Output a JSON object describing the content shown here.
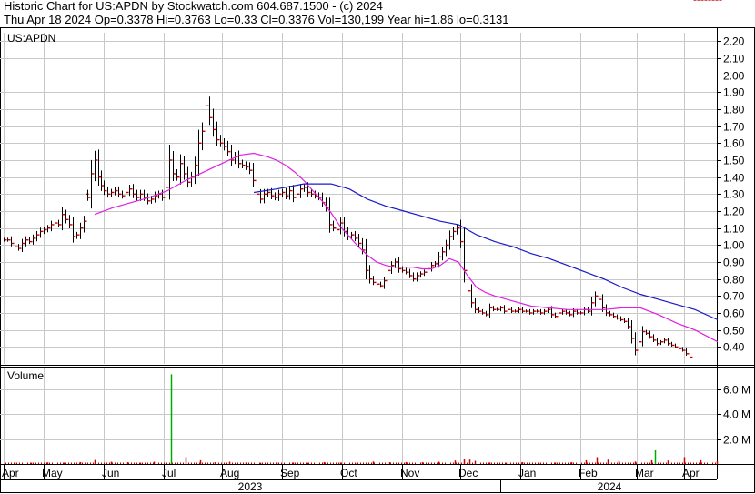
{
  "header": {
    "line1": "Historic Chart for US:APDN by Stockwatch.com 604.687.1500 - (c) 2024",
    "line2": "Thu Apr 18 2024   Op=0.3378   Hi=0.3763   Lo=0.33   Cl=0.3376   Vol=130,199   Year hi=1.86   lo=0.3131"
  },
  "colors": {
    "price_bar": "#000000",
    "close_tick": "#cc0000",
    "ma_short": "#e020e0",
    "ma_long": "#1a1acc",
    "volume_bar": "#cc0000",
    "volume_spike": "#00aa00",
    "grid": "#c8c8c8"
  },
  "chart_data": [
    {
      "type": "bar",
      "subtype": "ohlc",
      "symbol_label": "US:APDN",
      "yticks": [
        "0.40",
        "0.50",
        "0.60",
        "0.70",
        "0.80",
        "0.90",
        "1.00",
        "1.10",
        "1.20",
        "1.30",
        "1.40",
        "1.50",
        "1.60",
        "1.70",
        "1.80",
        "1.90",
        "2.00",
        "2.10",
        "2.20"
      ],
      "ylim": [
        0.3,
        2.25
      ],
      "months": [
        "Apr",
        "May",
        "Jun",
        "Jul",
        "Aug",
        "Sep",
        "Oct",
        "Nov",
        "Dec",
        "Jan",
        "Feb",
        "Mar",
        "Apr"
      ],
      "years": [
        "2023",
        "2024"
      ],
      "grid": true,
      "series": [
        {
          "kind": "ohlc_close_path",
          "x": [
            0,
            4,
            8,
            12,
            16,
            20,
            24,
            28,
            32,
            36,
            40,
            44,
            48,
            52,
            56,
            60,
            64,
            68,
            72,
            76,
            80,
            84,
            88,
            90,
            92,
            96,
            100,
            104,
            107,
            110,
            114,
            118,
            122,
            126,
            130,
            134,
            138,
            142,
            146,
            150,
            154,
            158,
            162,
            166,
            170,
            174,
            178,
            182,
            186,
            190,
            194,
            198,
            202,
            206,
            210,
            214,
            218,
            222,
            226,
            230,
            234,
            238,
            242,
            246,
            250,
            254,
            258,
            262,
            266,
            270,
            274,
            278,
            282,
            286,
            290,
            294,
            298,
            302,
            306,
            310,
            314,
            318,
            322,
            326,
            330,
            334,
            338,
            342,
            346,
            350,
            354,
            358,
            362,
            366,
            370,
            374,
            378,
            382,
            386,
            390,
            394,
            398,
            402,
            406,
            410,
            414,
            418,
            422,
            426,
            430,
            434,
            438,
            442,
            446,
            450,
            454,
            458,
            462,
            466,
            470,
            474,
            478,
            482,
            486,
            490,
            494,
            498,
            502,
            506,
            510,
            514,
            518,
            522,
            526,
            530,
            534,
            538,
            542,
            546,
            550,
            554,
            558,
            562,
            566,
            570,
            574,
            578,
            582,
            586,
            590,
            594,
            598,
            602,
            606,
            610,
            614,
            618,
            622,
            626,
            630,
            634,
            638,
            642,
            646,
            650,
            654,
            658,
            662,
            666,
            670,
            674,
            678,
            682,
            686,
            690,
            694,
            698,
            702,
            706,
            710,
            714,
            718,
            722,
            726,
            730,
            734,
            738,
            742,
            746,
            750,
            754,
            758,
            762,
            766,
            770,
            774,
            778,
            782,
            786
          ],
          "close": [
            1.03,
            1.03,
            1.01,
            0.99,
            0.98,
            1.01,
            1.03,
            1.02,
            1.04,
            1.06,
            1.08,
            1.09,
            1.1,
            1.12,
            1.13,
            1.12,
            1.18,
            1.15,
            1.12,
            1.05,
            1.06,
            1.1,
            1.14,
            1.3,
            1.28,
            1.42,
            1.5,
            1.4,
            1.35,
            1.32,
            1.3,
            1.31,
            1.32,
            1.3,
            1.29,
            1.31,
            1.33,
            1.3,
            1.28,
            1.3,
            1.28,
            1.26,
            1.27,
            1.29,
            1.3,
            1.28,
            1.34,
            1.5,
            1.42,
            1.4,
            1.48,
            1.42,
            1.37,
            1.4,
            1.47,
            1.6,
            1.67,
            1.82,
            1.75,
            1.68,
            1.62,
            1.6,
            1.58,
            1.55,
            1.5,
            1.52,
            1.48,
            1.47,
            1.46,
            1.44,
            1.38,
            1.3,
            1.27,
            1.3,
            1.31,
            1.29,
            1.28,
            1.3,
            1.31,
            1.29,
            1.32,
            1.28,
            1.3,
            1.33,
            1.34,
            1.31,
            1.3,
            1.29,
            1.28,
            1.25,
            1.22,
            1.12,
            1.1,
            1.09,
            1.13,
            1.08,
            1.05,
            1.06,
            1.04,
            1.01,
            0.97,
            0.85,
            0.8,
            0.78,
            0.77,
            0.76,
            0.79,
            0.85,
            0.88,
            0.9,
            0.86,
            0.85,
            0.84,
            0.82,
            0.8,
            0.82,
            0.83,
            0.84,
            0.86,
            0.88,
            0.89,
            0.93,
            0.96,
            1.0,
            1.05,
            1.08,
            1.1,
            1.02,
            0.85,
            0.73,
            0.66,
            0.62,
            0.61,
            0.6,
            0.59,
            0.63,
            0.62,
            0.62,
            0.63,
            0.61,
            0.62,
            0.61,
            0.61,
            0.62,
            0.61,
            0.61,
            0.6,
            0.61,
            0.61,
            0.6,
            0.61,
            0.62,
            0.59,
            0.58,
            0.6,
            0.61,
            0.6,
            0.59,
            0.61,
            0.6,
            0.6,
            0.62,
            0.61,
            0.66,
            0.7,
            0.68,
            0.63,
            0.6,
            0.59,
            0.58,
            0.57,
            0.56,
            0.55,
            0.52,
            0.45,
            0.38,
            0.43,
            0.49,
            0.48,
            0.46,
            0.44,
            0.42,
            0.43,
            0.44,
            0.42,
            0.41,
            0.4,
            0.39,
            0.38,
            0.36,
            0.34
          ]
        },
        {
          "kind": "moving_average_short",
          "x": [
            0,
            40,
            80,
            100,
            120,
            140,
            160,
            180,
            200,
            220,
            240,
            260,
            275,
            290,
            300,
            310,
            320,
            330,
            340,
            350,
            360,
            370,
            380,
            390,
            400,
            410,
            420,
            430,
            440,
            450,
            460,
            470,
            480,
            490,
            500,
            510,
            520,
            530,
            540,
            560,
            580,
            600,
            620,
            640,
            660,
            680,
            700,
            720,
            740,
            760,
            785
          ],
          "values": [
            null,
            null,
            null,
            1.18,
            1.22,
            1.25,
            1.28,
            1.32,
            1.38,
            1.43,
            1.48,
            1.53,
            1.54,
            1.52,
            1.5,
            1.47,
            1.43,
            1.38,
            1.32,
            1.26,
            1.19,
            1.11,
            1.05,
            0.99,
            0.94,
            0.9,
            0.88,
            0.87,
            0.87,
            0.87,
            0.86,
            0.86,
            0.88,
            0.92,
            0.9,
            0.82,
            0.75,
            0.72,
            0.7,
            0.67,
            0.64,
            0.63,
            0.62,
            0.62,
            0.62,
            0.63,
            0.63,
            0.59,
            0.54,
            0.5,
            0.43
          ]
        },
        {
          "kind": "moving_average_long",
          "x": [
            275,
            300,
            330,
            360,
            380,
            400,
            420,
            440,
            460,
            480,
            500,
            520,
            540,
            560,
            580,
            600,
            620,
            640,
            660,
            680,
            700,
            720,
            740,
            760,
            785
          ],
          "values": [
            1.31,
            1.33,
            1.36,
            1.36,
            1.33,
            1.27,
            1.23,
            1.2,
            1.17,
            1.14,
            1.12,
            1.06,
            1.02,
            0.99,
            0.95,
            0.92,
            0.88,
            0.84,
            0.8,
            0.75,
            0.71,
            0.68,
            0.65,
            0.62,
            0.56
          ]
        }
      ]
    },
    {
      "type": "bar",
      "subtype": "volume",
      "title": "Volume",
      "yticks": [
        "2.0 M",
        "4.0 M",
        "6.0 M"
      ],
      "ylim": [
        0,
        7.3
      ],
      "x": [
        12,
        30,
        48,
        66,
        84,
        100,
        118,
        136,
        150,
        165,
        184,
        200,
        216,
        232,
        248,
        266,
        282,
        300,
        318,
        334,
        352,
        370,
        388,
        406,
        424,
        442,
        460,
        478,
        496,
        506,
        512,
        518,
        534,
        552,
        570,
        588,
        606,
        624,
        640,
        652,
        664,
        676,
        694,
        712,
        716,
        730,
        748,
        766,
        784
      ],
      "values": [
        0.12,
        0.1,
        0.13,
        0.11,
        0.15,
        0.32,
        0.18,
        0.14,
        0.1,
        0.18,
        7.2,
        0.55,
        0.3,
        0.14,
        0.18,
        0.12,
        0.1,
        0.14,
        0.12,
        0.1,
        0.15,
        0.12,
        0.1,
        0.2,
        0.14,
        0.15,
        0.14,
        0.18,
        0.28,
        0.4,
        0.35,
        0.25,
        0.12,
        0.1,
        0.15,
        0.1,
        0.12,
        0.14,
        0.3,
        0.55,
        0.35,
        0.25,
        0.2,
        0.3,
        1.1,
        0.28,
        0.55,
        0.3,
        0.22
      ],
      "spike_index": 10
    }
  ]
}
